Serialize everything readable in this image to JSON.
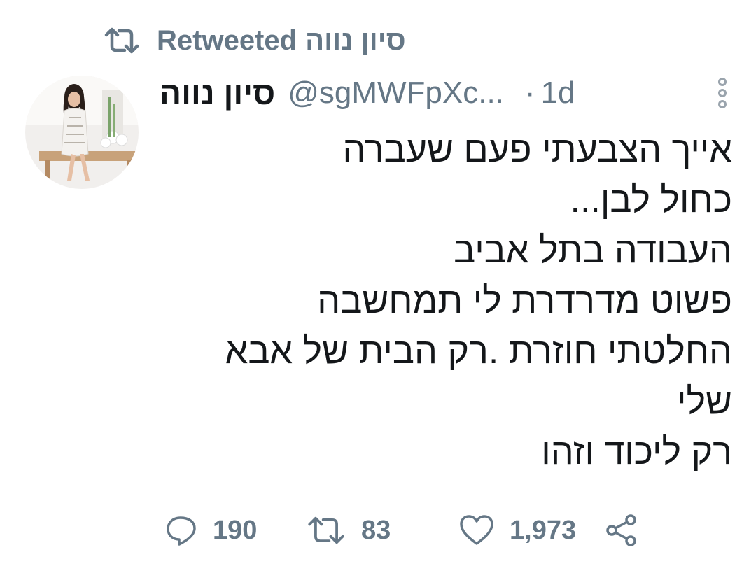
{
  "retweet_banner": {
    "label": "Retweeted",
    "retweeter_name": "סיון נווה",
    "icon": "retweet-icon"
  },
  "tweet": {
    "author": {
      "display_name": "סיון נווה",
      "handle": "@sgMWFpXc...",
      "avatar": "profile-photo"
    },
    "separator": "·",
    "time": "1d",
    "lines": [
      "אייך הצבעתי פעם שעברה",
      "כחול לבן...",
      "העבודה בתל אביב",
      "פשוט מדרדרת לי תמחשבה",
      "החלטתי חוזרת .רק הבית של אבא",
      "שלי",
      "רק ליכוד וזהו"
    ],
    "actions": {
      "replies": "190",
      "retweets": "83",
      "likes": "1,973"
    }
  },
  "colors": {
    "text": "#14171a",
    "secondary": "#657786",
    "background": "#ffffff"
  }
}
